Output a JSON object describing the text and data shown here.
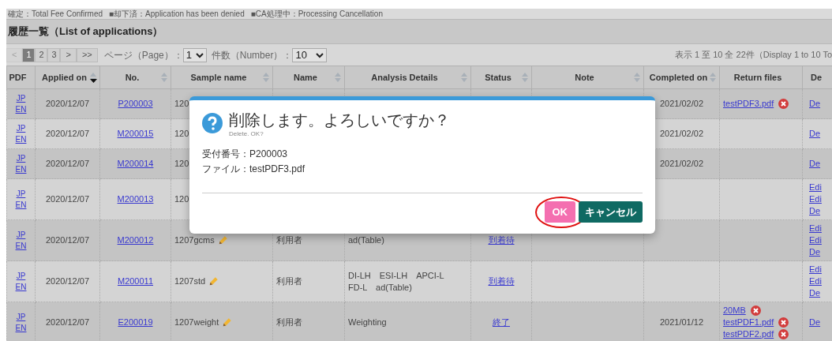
{
  "legend": [
    "確定：Total Fee Confirmed",
    "■却下済：Application has been denied",
    "■CA処理中：Processing Cancellation"
  ],
  "section_title": "履歴一覧（List of applications）",
  "pager": {
    "pages": [
      {
        "label": "<",
        "kind": "nav",
        "disabled": true,
        "selected": false
      },
      {
        "label": "1",
        "kind": "page",
        "disabled": false,
        "selected": true
      },
      {
        "label": "2",
        "kind": "page",
        "disabled": false,
        "selected": false
      },
      {
        "label": "3",
        "kind": "page",
        "disabled": false,
        "selected": false
      },
      {
        "label": ">",
        "kind": "nav",
        "disabled": false,
        "selected": false
      },
      {
        "label": ">>",
        "kind": "nav",
        "disabled": false,
        "selected": false
      }
    ],
    "page_label": "ページ（Page）：",
    "page_value": "1",
    "count_label": "件数（Number）：",
    "count_value": "10",
    "summary": "表示 1 至 10 全 22件（Display 1 to 10 To"
  },
  "table": {
    "columns": [
      {
        "label": "PDF",
        "sortable": false,
        "sorted": false
      },
      {
        "label": "Applied on",
        "sortable": true,
        "sorted": true
      },
      {
        "label": "No.",
        "sortable": true,
        "sorted": false
      },
      {
        "label": "Sample name",
        "sortable": true,
        "sorted": false
      },
      {
        "label": "Name",
        "sortable": true,
        "sorted": false
      },
      {
        "label": "Analysis Details",
        "sortable": true,
        "sorted": false
      },
      {
        "label": "Status",
        "sortable": true,
        "sorted": false
      },
      {
        "label": "Note",
        "sortable": true,
        "sorted": false
      },
      {
        "label": "Completed on",
        "sortable": true,
        "sorted": false
      },
      {
        "label": "Return files",
        "sortable": false,
        "sorted": false
      },
      {
        "label": "De",
        "sortable": false,
        "sorted": false
      }
    ],
    "rows": [
      {
        "pdf": [
          "JP",
          "EN"
        ],
        "applied": "2020/12/07",
        "no": "P200003",
        "sample": "120",
        "editable": false,
        "completed": "2021/02/02",
        "files": [
          "testPDF3.pdf"
        ],
        "actions": [
          "De"
        ]
      },
      {
        "pdf": [
          "JP",
          "EN"
        ],
        "applied": "2020/12/07",
        "no": "M200015",
        "sample": "120",
        "editable": false,
        "completed": "2021/02/02",
        "actions": [
          "De"
        ]
      },
      {
        "pdf": [
          "JP",
          "EN"
        ],
        "applied": "2020/12/07",
        "no": "M200014",
        "sample": "120",
        "editable": false,
        "completed": "2021/02/02",
        "actions": [
          "De"
        ]
      },
      {
        "pdf": [
          "JP",
          "EN"
        ],
        "applied": "2020/12/07",
        "no": "M200013",
        "sample": "120",
        "editable": false,
        "actions": [
          "Edi",
          "Edi",
          "De"
        ]
      },
      {
        "pdf": [
          "JP",
          "EN"
        ],
        "applied": "2020/12/07",
        "no": "M200012",
        "sample": "1207gcms",
        "editable": true,
        "name": "利用者",
        "details": [
          "ad(Table)"
        ],
        "status": "到着待",
        "actions": [
          "Edi",
          "Edi",
          "De"
        ]
      },
      {
        "pdf": [
          "JP",
          "EN"
        ],
        "applied": "2020/12/07",
        "no": "M200011",
        "sample": "1207std",
        "editable": true,
        "name": "利用者",
        "details": [
          "DI-LH　ESI-LH　APCI-L",
          "FD-L　ad(Table)"
        ],
        "status": "到着待",
        "actions": [
          "Edi",
          "Edi",
          "De"
        ]
      },
      {
        "pdf": [
          "JP",
          "EN"
        ],
        "applied": "2020/12/07",
        "no": "E200019",
        "sample": "1207weight",
        "editable": true,
        "name": "利用者",
        "details": [
          "Weighting"
        ],
        "status": "終了",
        "completed": "2021/01/12",
        "files": [
          "20MB",
          "testPDF1.pdf",
          "testPDF2.pdf"
        ],
        "actions": [
          "De"
        ]
      }
    ]
  },
  "dialog": {
    "title": "削除します。よろしいですか？",
    "subtitle": "Delete. OK?",
    "lines": [
      "受付番号：P200003",
      "ファイル：testPDF3.pdf"
    ],
    "buttons": [
      {
        "label": "OK",
        "kind": "primary",
        "highlighted": true
      },
      {
        "label": "キャンセル",
        "kind": "secondary",
        "highlighted": false
      }
    ]
  }
}
